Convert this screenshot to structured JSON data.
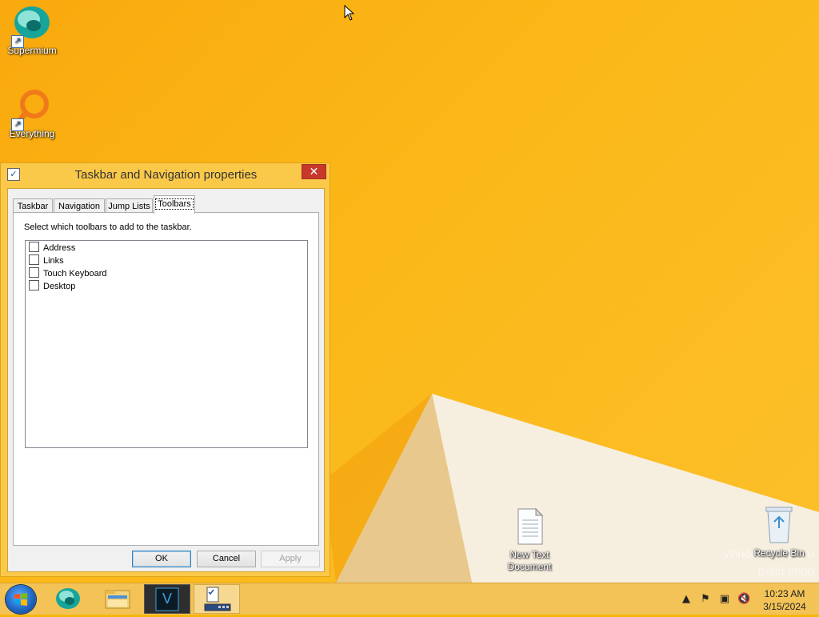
{
  "desktop": {
    "icons": [
      {
        "label": "Supermium",
        "icon": "supermium-icon"
      },
      {
        "label": "Everything",
        "icon": "everything-icon"
      },
      {
        "label": "New Text Document",
        "label_line1": "New Text",
        "label_line2": "Document",
        "icon": "text-document-icon"
      },
      {
        "label": "Recycle Bin",
        "icon": "recycle-bin-icon"
      }
    ],
    "watermark": {
      "line1": "Windows 8.1 Pro",
      "line2": "Build 9600"
    }
  },
  "dialog": {
    "title": "Taskbar and Navigation properties",
    "close_label": "✕",
    "tabs": [
      {
        "label": "Taskbar",
        "active": false
      },
      {
        "label": "Navigation",
        "active": false
      },
      {
        "label": "Jump Lists",
        "active": false
      },
      {
        "label": "Toolbars",
        "active": true
      }
    ],
    "instruction": "Select which toolbars to add to the taskbar.",
    "toolbars": [
      {
        "label": "Address",
        "checked": false
      },
      {
        "label": "Links",
        "checked": false
      },
      {
        "label": "Touch Keyboard",
        "checked": false
      },
      {
        "label": "Desktop",
        "checked": false
      }
    ],
    "buttons": {
      "ok": "OK",
      "cancel": "Cancel",
      "apply": "Apply"
    }
  },
  "taskbar": {
    "items": [
      {
        "name": "start-button",
        "icon": "windows-logo-icon"
      },
      {
        "name": "supermium",
        "icon": "supermium-icon"
      },
      {
        "name": "file-explorer",
        "icon": "file-explorer-icon"
      },
      {
        "name": "v-app",
        "icon": "v-app-icon",
        "letter": "V"
      },
      {
        "name": "taskbar-properties",
        "icon": "taskbar-properties-icon",
        "active": true
      }
    ],
    "clock": {
      "time": "10:23 AM",
      "date": "3/15/2024"
    }
  },
  "colors": {
    "desktop_bg": "#f9a90d",
    "taskbar_bg": "#f3c357",
    "close_button": "#c7382b"
  }
}
